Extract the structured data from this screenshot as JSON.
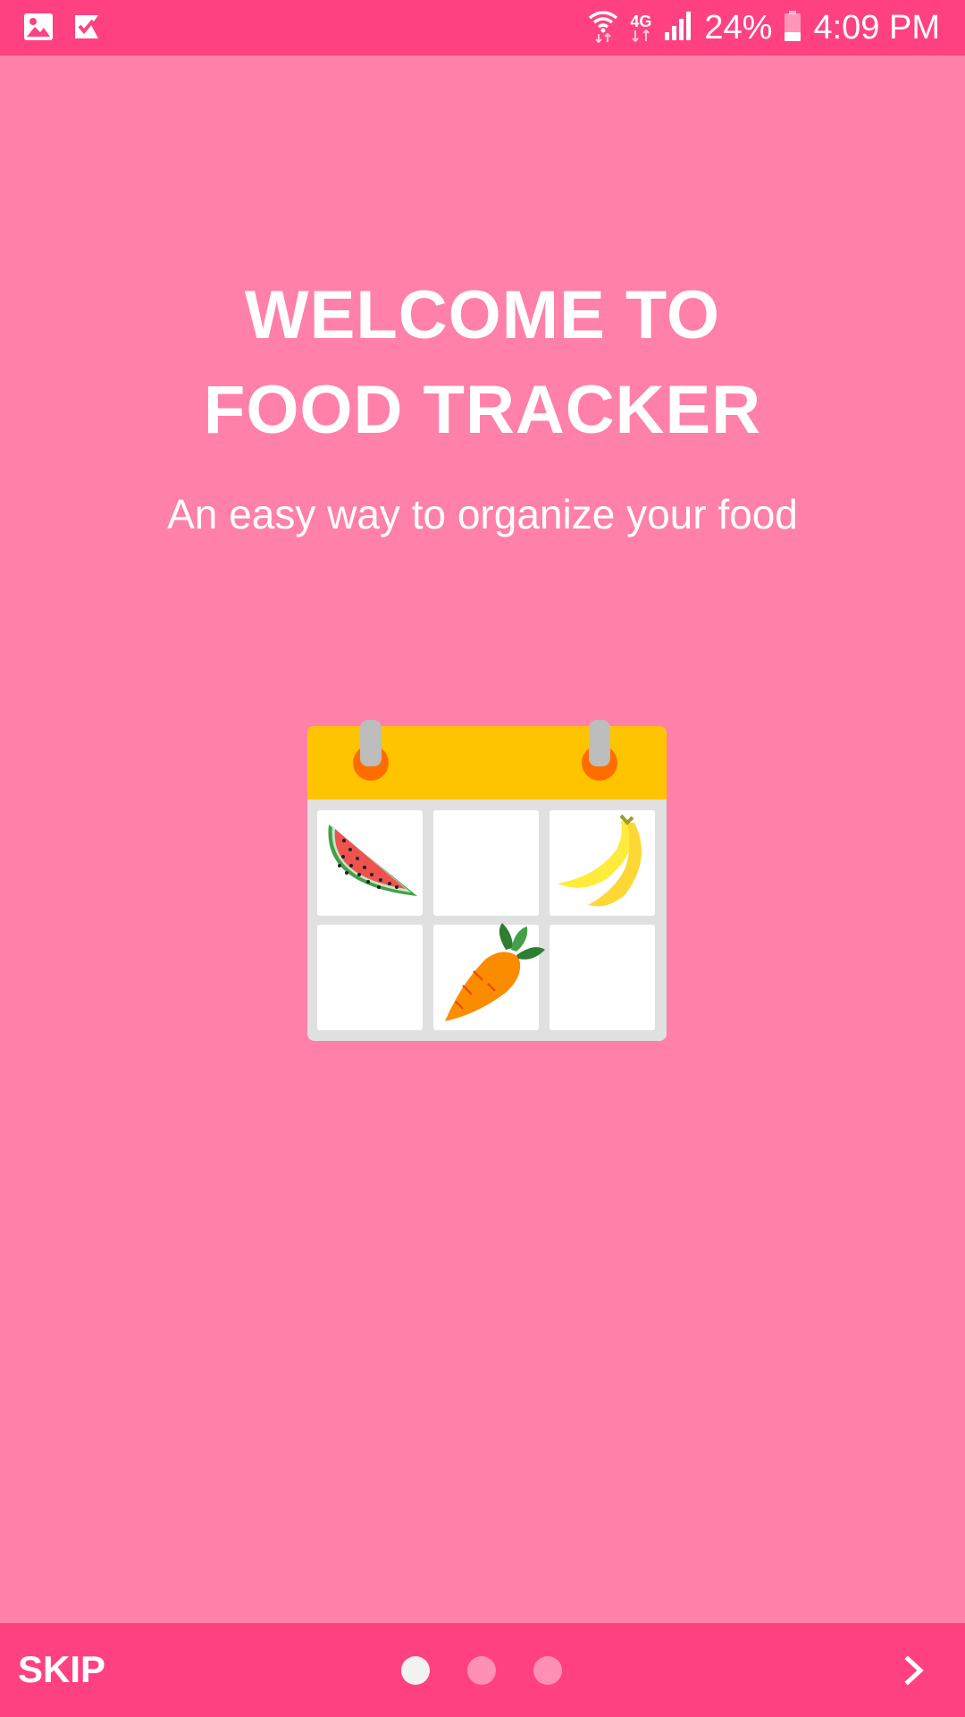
{
  "status_bar": {
    "network_label": "4G",
    "battery_percent": "24%",
    "time": "4:09 PM",
    "left_icons": [
      "image-icon",
      "check-flag-icon"
    ],
    "right_icons": [
      "wifi-icon",
      "network-4g-icon",
      "signal-icon",
      "battery-icon"
    ]
  },
  "onboarding": {
    "title_line1": "WELCOME TO",
    "title_line2": "FOOD TRACKER",
    "subtitle": "An easy way to organize your food",
    "illustration": {
      "name": "calendar-food-illustration",
      "cells": [
        "watermelon",
        "",
        "banana",
        "",
        "carrot",
        ""
      ]
    }
  },
  "bottom_bar": {
    "skip_label": "SKIP",
    "page_count": 3,
    "active_page": 1,
    "next_icon": "chevron-right-icon"
  },
  "colors": {
    "background": "#FF80A8",
    "bars": "#FF4181",
    "calendar_header": "#FFC400"
  }
}
